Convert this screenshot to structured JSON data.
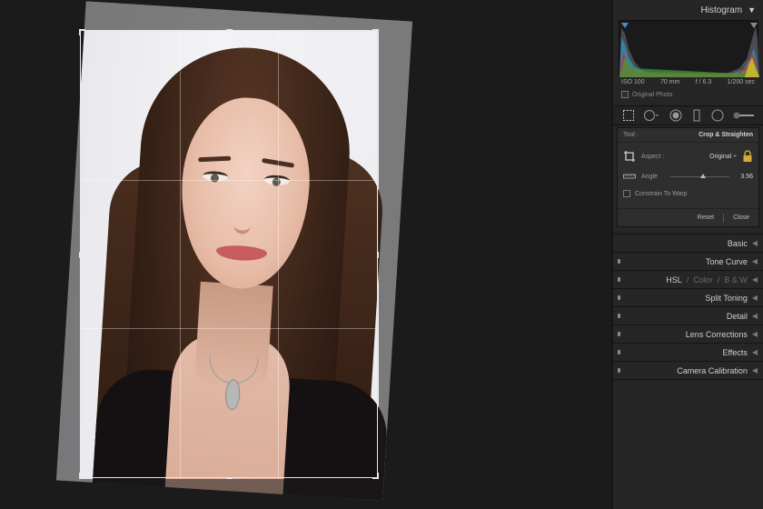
{
  "panel": {
    "histogram": {
      "title": "Histogram",
      "iso": "ISO 100",
      "focal": "70 mm",
      "aperture": "f / 6.3",
      "shutter": "1/200 sec",
      "original_photo": "Original Photo"
    },
    "crop": {
      "tool_label": "Tool :",
      "tool_value": "Crop & Straighten",
      "aspect_label": "Aspect :",
      "aspect_value": "Original ÷",
      "angle_label": "Angle",
      "angle_value": "3.56",
      "constrain_label": "Constrain To Warp",
      "reset_label": "Reset",
      "close_label": "Close"
    },
    "sections": {
      "basic": "Basic",
      "tone_curve": "Tone Curve",
      "hsl": "HSL",
      "hsl_sep1": "/",
      "color": "Color",
      "hsl_sep2": "/",
      "bw": "B & W",
      "split_toning": "Split Toning",
      "detail": "Detail",
      "lens_corrections": "Lens Corrections",
      "effects": "Effects",
      "camera_calibration": "Camera Calibration"
    }
  },
  "icons": {
    "collapse": "triangle-down",
    "expand": "triangle-left",
    "lock": "lock-icon"
  },
  "colors": {
    "panel_bg": "#262626",
    "canvas_bg": "#1b1b1b",
    "text": "#cfcfcf"
  }
}
